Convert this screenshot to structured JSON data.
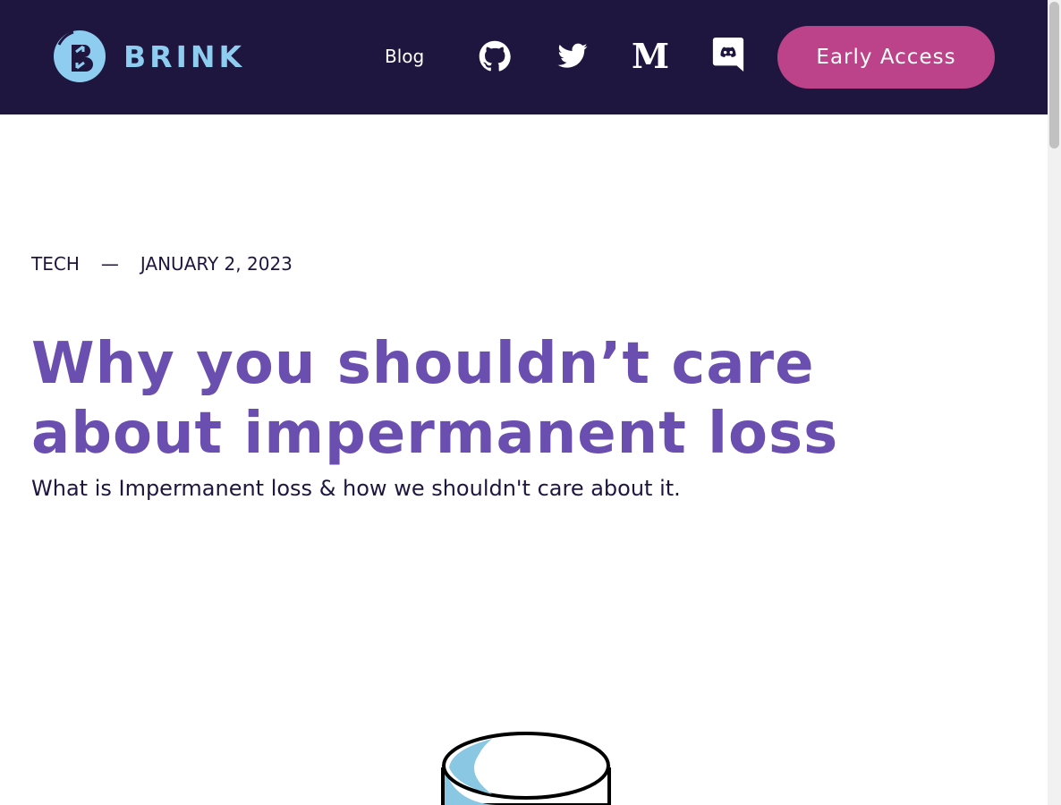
{
  "header": {
    "logo_text": "BRINK",
    "nav": {
      "blog_label": "Blog"
    },
    "social_icons": [
      "github-icon",
      "twitter-icon",
      "medium-icon",
      "discord-icon"
    ],
    "medium_glyph": "M",
    "cta_label": "Early Access"
  },
  "article": {
    "category": "TECH",
    "separator": "—",
    "date": "JANUARY 2, 2023",
    "title": "Why you shouldn’t care about impermanent loss",
    "subtitle": "What is Impermanent loss & how we shouldn't care about it."
  },
  "colors": {
    "header_bg": "#1f1640",
    "accent_purple": "#6a4fb0",
    "cta_pink": "#bc4389",
    "logo_blue": "#8ecdf0"
  }
}
